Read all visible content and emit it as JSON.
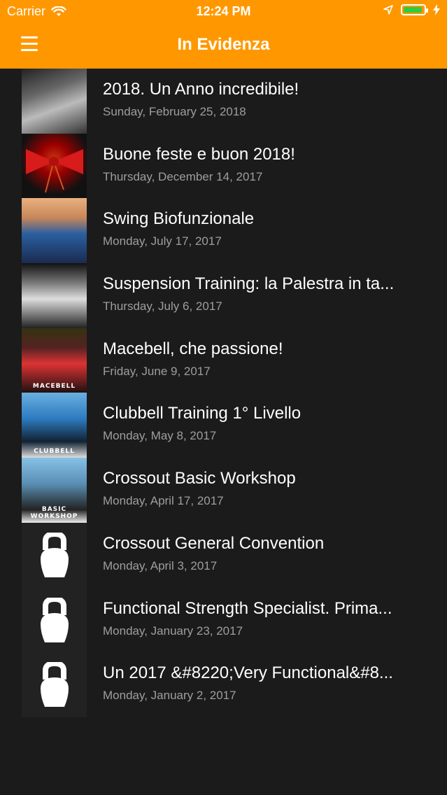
{
  "status_bar": {
    "carrier": "Carrier",
    "time": "12:24 PM"
  },
  "nav": {
    "title": "In Evidenza"
  },
  "posts": [
    {
      "title": "2018. Un Anno incredibile!",
      "date": "Sunday, February 25, 2018"
    },
    {
      "title": "Buone feste e buon 2018!",
      "date": "Thursday, December 14, 2017"
    },
    {
      "title": "Swing Biofunzionale",
      "date": "Monday, July 17, 2017"
    },
    {
      "title": "Suspension Training: la Palestra in ta...",
      "date": "Thursday, July 6, 2017"
    },
    {
      "title": "Macebell, che passione!",
      "date": "Friday, June 9, 2017"
    },
    {
      "title": "Clubbell Training 1° Livello",
      "date": "Monday, May 8, 2017"
    },
    {
      "title": "Crossout Basic Workshop",
      "date": "Monday, April 17, 2017"
    },
    {
      "title": "Crossout General Convention",
      "date": "Monday, April 3, 2017"
    },
    {
      "title": "Functional Strength Specialist. Prima...",
      "date": "Monday, January 23, 2017"
    },
    {
      "title": "Un 2017 &#8220;Very Functional&#8...",
      "date": "Monday, January 2, 2017"
    }
  ],
  "thumb_captions": {
    "macebell": "MACEBELL",
    "clubbell": "CLUBBELL",
    "basic": "BASIC WORKSHOP"
  },
  "colors": {
    "accent": "#ff9800",
    "background": "#1b1b1b",
    "title_text": "#ffffff",
    "date_text": "#9e9e9e"
  },
  "icons": {
    "menu": "hamburger-menu-icon",
    "wifi": "wifi-icon",
    "location": "location-arrow-icon",
    "battery": "battery-icon",
    "placeholder": "kettlebell-icon"
  }
}
